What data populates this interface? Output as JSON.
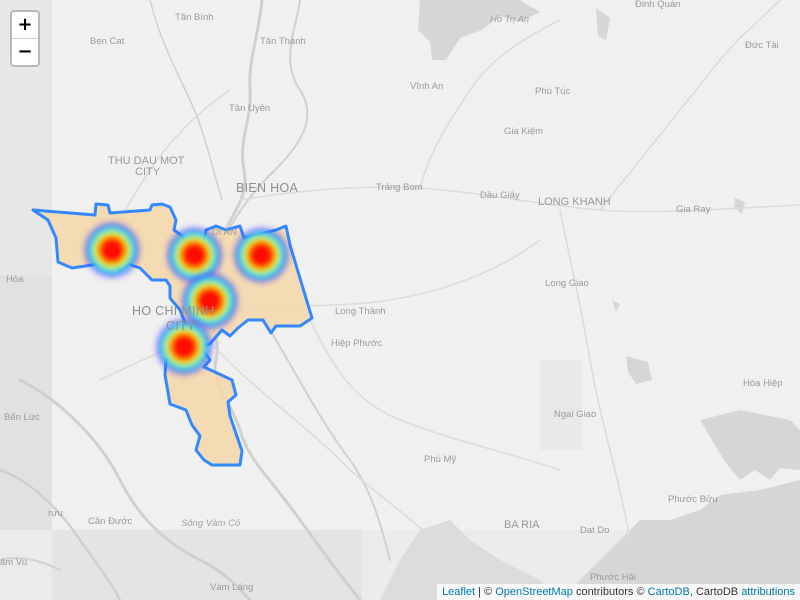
{
  "zoom_control": {
    "zoom_in_label": "+",
    "zoom_out_label": "−"
  },
  "place_labels": {
    "tan_binh": "Tân Bình",
    "dinh_quan": "Định Quán",
    "ho_tri_an": "Hồ Trị An",
    "ben_cat": "Ben Cat",
    "tan_thanh": "Tân Thành",
    "duc_tai": "Đức Tài",
    "vinh_an": "Vĩnh An",
    "phu_tuc": "Phú Túc",
    "tan_uyen": "Tân Uyên",
    "gia_kiem": "Gia Kiệm",
    "thu_dau_mot_1": "THU DAU MOT",
    "thu_dau_mot_2": "CITY",
    "bien_hoa": "BIEN HOA",
    "trang_bom": "Trảng Bom",
    "dau_giay": "Dầu Giây",
    "long_khanh": "LONG KHANH",
    "gia_ray": "Gia Ray",
    "di_an": "DI AN",
    "hoa": "Hòa",
    "long_giao": "Long Giao",
    "ho_chi_minh_1": "HO CHI MINH",
    "ho_chi_minh_2": "CITY",
    "long_thanh": "Long Thành",
    "hiep_phuoc": "Hiệp Phước",
    "hoa_hiep": "Hòa Hiệp",
    "ben_luc": "Bến Lức",
    "ngai_giao": "Ngai Giao",
    "phu_my": "Phú Mỹ",
    "phuoc_buu": "Phước Bửu",
    "ruu": "rựu",
    "can_duoc": "Cần Đước",
    "song_vam_co": "Sông Vàm Cỏ",
    "ba_ria": "BA RIA",
    "dat_do": "Dat Do",
    "am_vu": "âm Vu",
    "vam_lang": "Vàm Láng",
    "phuoc_hai": "Phước Hải"
  },
  "heat_colors": [
    "#ff0000",
    "#ff7a00",
    "#ffee00",
    "#66ff33",
    "#00e5ff",
    "#2255ff",
    "#4020ff"
  ],
  "heatmap_points": [
    {
      "lon": 106.56,
      "lat": 10.87,
      "intensity": 0.9
    },
    {
      "lon": 106.72,
      "lat": 10.86,
      "intensity": 0.9
    },
    {
      "lon": 106.85,
      "lat": 10.86,
      "intensity": 0.85
    },
    {
      "lon": 106.75,
      "lat": 10.77,
      "intensity": 1.0
    },
    {
      "lon": 106.7,
      "lat": 10.68,
      "intensity": 0.95
    }
  ],
  "region_style": {
    "outline_color": "#3388ff",
    "fill_color": "#f5d7a8"
  },
  "attribution": {
    "leaflet": "Leaflet",
    "sep1": " | © ",
    "osm": "OpenStreetMap",
    "contrib": " contributors © ",
    "cartodb": "CartoDB",
    "sep2": ", CartoDB ",
    "attributions": "attributions"
  }
}
